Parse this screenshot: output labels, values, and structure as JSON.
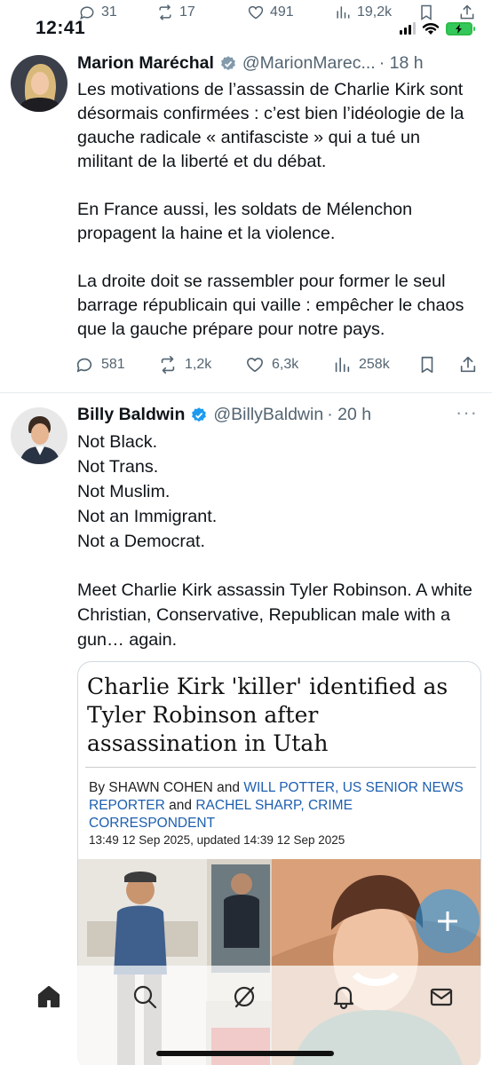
{
  "status_bar": {
    "time": "12:41"
  },
  "previous_tweet_actions": {
    "replies": "31",
    "reposts": "17",
    "likes": "491",
    "views": "19,2k"
  },
  "tweets": [
    {
      "author": "Marion Maréchal",
      "handle": "@MarionMarec...",
      "time": "· 18 h",
      "paragraphs": [
        "Les motivations de l’assassin de Charlie Kirk sont désormais confirmées : c’est bien l’idéologie de la gauche radicale « antifasciste » qui a tué un militant de la liberté et du débat.",
        "En France aussi, les soldats de Mélenchon propagent la haine et la violence.",
        "La droite doit se rassembler pour former le seul barrage républicain qui vaille : empêcher le chaos que la gauche prépare pour notre pays."
      ],
      "stats": {
        "replies": "581",
        "reposts": "1,2k",
        "likes": "6,3k",
        "views": "258k"
      }
    },
    {
      "author": "Billy Baldwin",
      "handle": "@BillyBaldwin",
      "time": "· 20 h",
      "lines": [
        "Not Black.",
        "Not Trans.",
        "Not Muslim.",
        "Not an Immigrant.",
        "Not a Democrat."
      ],
      "paragraph": "Meet Charlie Kirk assassin Tyler Robinson. A white Christian, Conservative, Republican male with a gun… again.",
      "card": {
        "headline": "Charlie Kirk 'killer' identified as Tyler Robinson after assassination in Utah",
        "by": "By",
        "author1": "SHAWN COHEN",
        "and1": "and",
        "author2": "WILL POTTER, US SENIOR NEWS REPORTER",
        "and2": "and",
        "author3": "RACHEL SHARP, CRIME CORRESPONDENT",
        "dateline": "13:49 12 Sep 2025, updated 14:39 12 Sep 2025"
      }
    }
  ],
  "colors": {
    "accent": "#1d9bf0",
    "secondary_text": "#536471",
    "verified": "#1d9bf0",
    "link": "#1d5fb0"
  }
}
